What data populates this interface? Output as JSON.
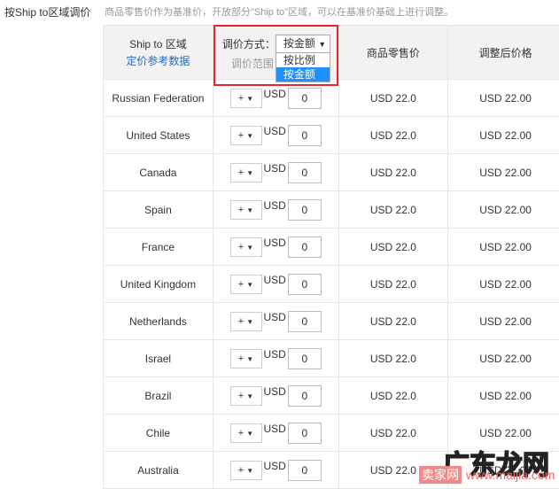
{
  "section_label": "按Ship to区域调价",
  "description": "商品零售价作为基准价，开放部分\"Ship to\"区域，可以在基准价基础上进行调整。",
  "header": {
    "region": "Ship to 区域",
    "reference_link": "定价参考数据",
    "mode_label": "调价方式：",
    "mode_selected": "按金额",
    "range_label": "调价范围",
    "retail": "商品零售价",
    "adjusted": "调整后价格"
  },
  "dropdown_options": [
    "按比例",
    "按金额"
  ],
  "rows": [
    {
      "region": "Russian Federation",
      "op": "+",
      "currency": "USD",
      "amount": "0",
      "retail": "USD 22.0",
      "adjusted": "USD 22.00"
    },
    {
      "region": "United States",
      "op": "+",
      "currency": "USD",
      "amount": "0",
      "retail": "USD 22.0",
      "adjusted": "USD 22.00"
    },
    {
      "region": "Canada",
      "op": "+",
      "currency": "USD",
      "amount": "0",
      "retail": "USD 22.0",
      "adjusted": "USD 22.00"
    },
    {
      "region": "Spain",
      "op": "+",
      "currency": "USD",
      "amount": "0",
      "retail": "USD 22.0",
      "adjusted": "USD 22.00"
    },
    {
      "region": "France",
      "op": "+",
      "currency": "USD",
      "amount": "0",
      "retail": "USD 22.0",
      "adjusted": "USD 22.00"
    },
    {
      "region": "United Kingdom",
      "op": "+",
      "currency": "USD",
      "amount": "0",
      "retail": "USD 22.0",
      "adjusted": "USD 22.00"
    },
    {
      "region": "Netherlands",
      "op": "+",
      "currency": "USD",
      "amount": "0",
      "retail": "USD 22.0",
      "adjusted": "USD 22.00"
    },
    {
      "region": "Israel",
      "op": "+",
      "currency": "USD",
      "amount": "0",
      "retail": "USD 22.0",
      "adjusted": "USD 22.00"
    },
    {
      "region": "Brazil",
      "op": "+",
      "currency": "USD",
      "amount": "0",
      "retail": "USD 22.0",
      "adjusted": "USD 22.00"
    },
    {
      "region": "Chile",
      "op": "+",
      "currency": "USD",
      "amount": "0",
      "retail": "USD 22.0",
      "adjusted": "USD 22.00"
    },
    {
      "region": "Australia",
      "op": "+",
      "currency": "USD",
      "amount": "0",
      "retail": "USD 22.0",
      "adjusted": "USD 22.00"
    }
  ],
  "watermark": {
    "logo": "广东龙网",
    "site_name": "卖家网",
    "url": "www.maijia.com"
  }
}
